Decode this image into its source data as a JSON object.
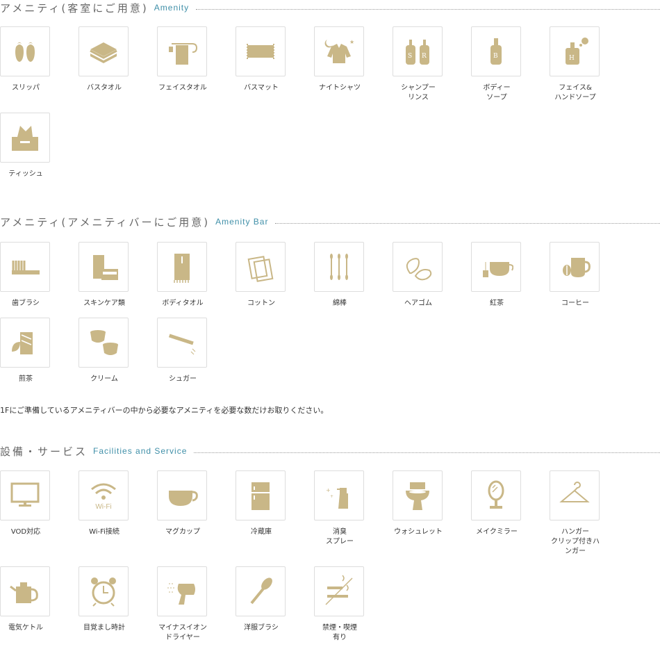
{
  "sections": [
    {
      "title_jp": "アメニティ(客室にご用意)",
      "title_en": "Amenity",
      "items": [
        {
          "label": "スリッパ",
          "icon": "slippers-icon"
        },
        {
          "label": "バスタオル",
          "icon": "bath-towel-icon"
        },
        {
          "label": "フェイスタオル",
          "icon": "face-towel-icon"
        },
        {
          "label": "バスマット",
          "icon": "bath-mat-icon"
        },
        {
          "label": "ナイトシャツ",
          "icon": "night-shirt-icon"
        },
        {
          "label": "シャンプー\nリンス",
          "icon": "shampoo-rinse-icon"
        },
        {
          "label": "ボディー\nソープ",
          "icon": "body-soap-icon"
        },
        {
          "label": "フェイス&\nハンドソープ",
          "icon": "hand-soap-icon"
        },
        {
          "label": "ティッシュ",
          "icon": "tissue-icon"
        }
      ]
    },
    {
      "title_jp": "アメニティ(アメニティバーにご用意)",
      "title_en": "Amenity Bar",
      "items": [
        {
          "label": "歯ブラシ",
          "icon": "toothbrush-icon"
        },
        {
          "label": "スキンケア類",
          "icon": "skincare-icon"
        },
        {
          "label": "ボディタオル",
          "icon": "body-towel-icon"
        },
        {
          "label": "コットン",
          "icon": "cotton-icon"
        },
        {
          "label": "綿棒",
          "icon": "cotton-swab-icon"
        },
        {
          "label": "ヘアゴム",
          "icon": "hair-tie-icon"
        },
        {
          "label": "紅茶",
          "icon": "tea-icon"
        },
        {
          "label": "コーヒー",
          "icon": "coffee-icon"
        },
        {
          "label": "煎茶",
          "icon": "green-tea-icon"
        },
        {
          "label": "クリーム",
          "icon": "creamer-icon"
        },
        {
          "label": "シュガー",
          "icon": "sugar-icon"
        }
      ],
      "note": "1Fにご準備しているアメニティバーの中から必要なアメニティを必要な数だけお取りください。"
    },
    {
      "title_jp": "設備・サービス",
      "title_en": "Facilities and Service",
      "items": [
        {
          "label": "VOD対応",
          "icon": "tv-icon"
        },
        {
          "label": "Wi-Fi接続",
          "icon": "wifi-icon",
          "icon_text": "Wi-Fi"
        },
        {
          "label": "マグカップ",
          "icon": "mug-icon"
        },
        {
          "label": "冷蔵庫",
          "icon": "fridge-icon"
        },
        {
          "label": "消臭\nスプレー",
          "icon": "spray-icon"
        },
        {
          "label": "ウォシュレット",
          "icon": "toilet-icon"
        },
        {
          "label": "メイクミラー",
          "icon": "mirror-icon"
        },
        {
          "label": "ハンガー\nクリップ付きハ\nンガー",
          "icon": "hanger-icon"
        },
        {
          "label": "電気ケトル",
          "icon": "kettle-icon"
        },
        {
          "label": "目覚まし時計",
          "icon": "alarm-clock-icon"
        },
        {
          "label": "マイナスイオン\nドライヤー",
          "icon": "hair-dryer-icon"
        },
        {
          "label": "洋服ブラシ",
          "icon": "clothes-brush-icon"
        },
        {
          "label": "禁煙・喫煙\n有り",
          "icon": "smoking-icon"
        }
      ]
    }
  ],
  "colors": {
    "icon": "#c9b787",
    "accent": "#3f8fa8",
    "border": "#dddddd"
  }
}
